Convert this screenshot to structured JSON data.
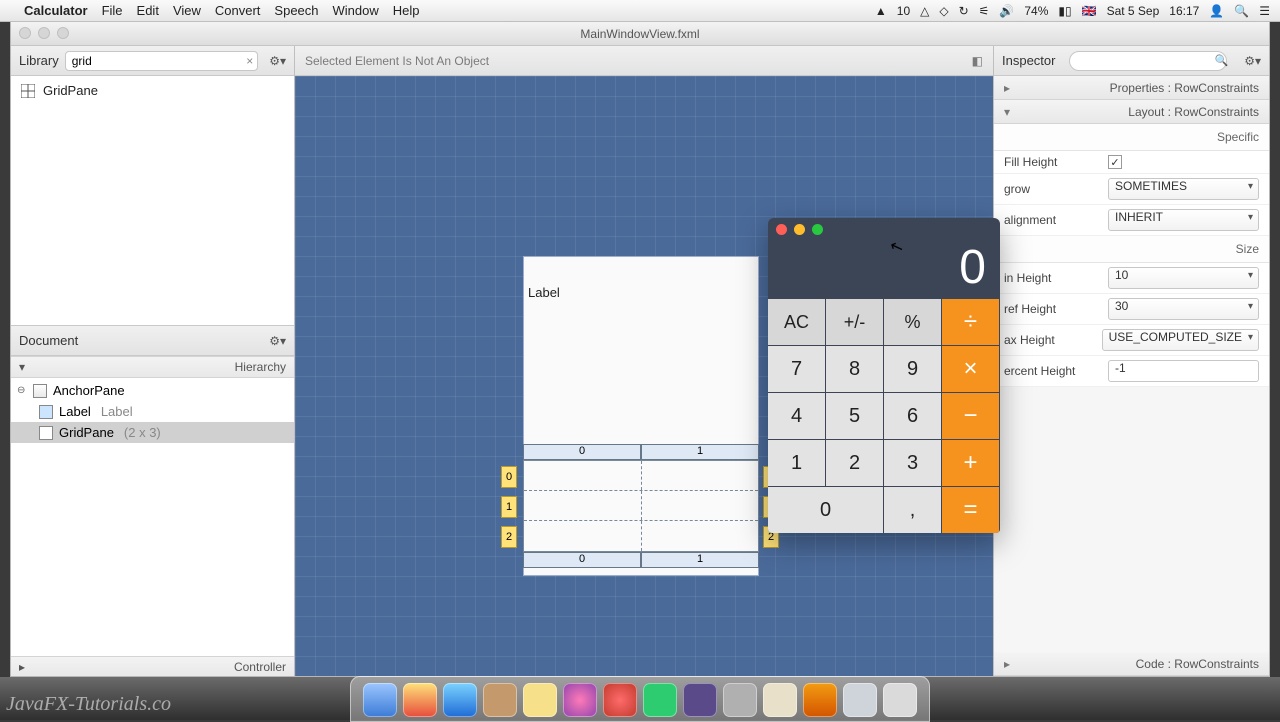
{
  "menubar": {
    "app": "Calculator",
    "items": [
      "File",
      "Edit",
      "View",
      "Convert",
      "Speech",
      "Window",
      "Help"
    ],
    "right": {
      "adobe": "10",
      "battery": "74%",
      "flag": "🇬🇧",
      "date": "Sat 5 Sep",
      "time": "16:17"
    }
  },
  "window": {
    "title": "MainWindowView.fxml"
  },
  "library": {
    "title": "Library",
    "search_value": "grid",
    "items": [
      {
        "label": "GridPane"
      }
    ]
  },
  "document": {
    "title": "Document",
    "hierarchy_label": "Hierarchy",
    "controller_label": "Controller",
    "tree": [
      {
        "label": "AnchorPane",
        "depth": 0,
        "disclose": "⊖"
      },
      {
        "label": "Label",
        "sub": "Label",
        "depth": 1
      },
      {
        "label": "GridPane",
        "sub": "(2 x 3)",
        "depth": 1,
        "sel": true
      }
    ]
  },
  "center": {
    "status": "Selected Element Is Not An Object",
    "preview_label": "Label",
    "cols": [
      "0",
      "1"
    ],
    "rows": [
      "0",
      "1",
      "2"
    ]
  },
  "inspector": {
    "title": "Inspector",
    "sections": {
      "properties": "Properties : RowConstraints",
      "layout": "Layout : RowConstraints",
      "code": "Code : RowConstraints"
    },
    "specific_label": "Specific",
    "size_label": "Size",
    "props": {
      "fill_height": {
        "label": "Fill Height",
        "checked": true
      },
      "vgrow": {
        "label": "grow",
        "value": "SOMETIMES"
      },
      "valignment": {
        "label": "alignment",
        "value": "INHERIT"
      },
      "min_height": {
        "label": "in Height",
        "value": "10"
      },
      "pref_height": {
        "label": "ref Height",
        "value": "30"
      },
      "max_height": {
        "label": "ax Height",
        "value": "USE_COMPUTED_SIZE"
      },
      "percent_height": {
        "label": "ercent Height",
        "value": "-1"
      }
    }
  },
  "calculator": {
    "display": "0",
    "keys": [
      [
        "AC",
        "fn"
      ],
      [
        "+/-",
        "fn"
      ],
      [
        "%",
        "fn"
      ],
      [
        "÷",
        "op"
      ],
      [
        "7",
        ""
      ],
      [
        "8",
        ""
      ],
      [
        "9",
        ""
      ],
      [
        "×",
        "op"
      ],
      [
        "4",
        ""
      ],
      [
        "5",
        ""
      ],
      [
        "6",
        ""
      ],
      [
        "−",
        "op"
      ],
      [
        "1",
        ""
      ],
      [
        "2",
        ""
      ],
      [
        "3",
        ""
      ],
      [
        "+",
        "op"
      ],
      [
        "0",
        "zero"
      ],
      [
        ",",
        ""
      ],
      [
        "=",
        "op"
      ]
    ]
  },
  "watermark": "JavaFX-Tutorials.co"
}
